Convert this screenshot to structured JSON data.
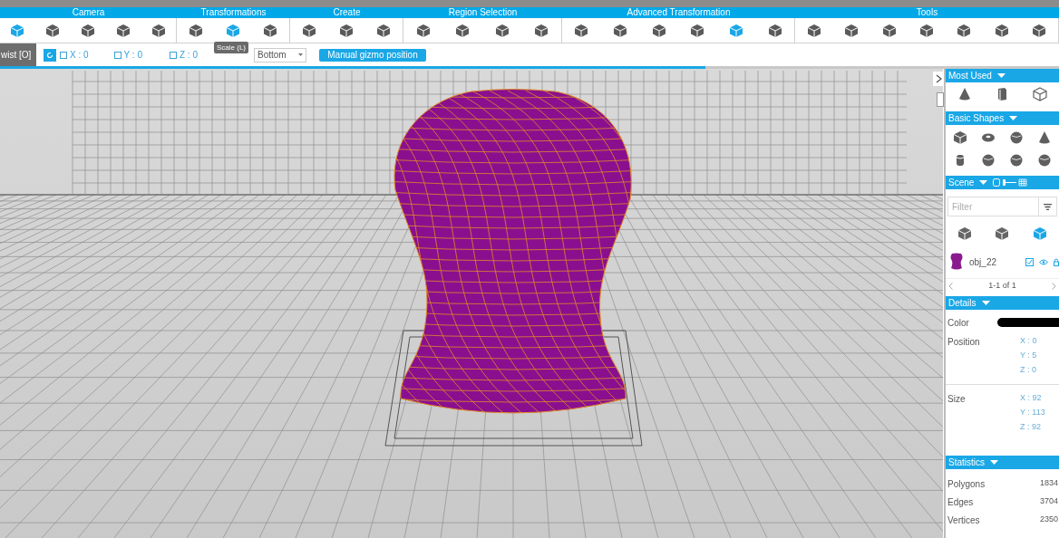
{
  "ribbon": {
    "groups": [
      {
        "label": "Camera",
        "tools": [
          {
            "selected": true
          },
          {
            "selected": false
          },
          {
            "selected": false
          },
          {
            "selected": false
          },
          {
            "selected": false
          }
        ]
      },
      {
        "label": "Transformations",
        "tools": [
          {
            "selected": false
          },
          {
            "selected": true
          },
          {
            "selected": false
          }
        ]
      },
      {
        "label": "Create",
        "tools": [
          {
            "selected": false
          },
          {
            "selected": false
          },
          {
            "selected": false
          }
        ]
      },
      {
        "label": "Region Selection",
        "tools": [
          {
            "selected": false
          },
          {
            "selected": false
          },
          {
            "selected": false
          },
          {
            "selected": false
          }
        ]
      },
      {
        "label": "Advanced Transformation",
        "tools": [
          {
            "selected": false
          },
          {
            "selected": false
          },
          {
            "selected": false
          },
          {
            "selected": false
          },
          {
            "selected": true
          },
          {
            "selected": false
          }
        ]
      },
      {
        "label": "Tools",
        "tools": [
          {
            "selected": false
          },
          {
            "selected": false
          },
          {
            "selected": false
          },
          {
            "selected": false
          },
          {
            "selected": false
          },
          {
            "selected": false
          },
          {
            "selected": false
          }
        ]
      }
    ]
  },
  "tooltip": {
    "text": "Scale (L)"
  },
  "options_bar": {
    "mode_label": "wist [O]",
    "rotate_active": true,
    "axes": [
      {
        "label": "X : 0",
        "checked": false
      },
      {
        "label": "Y : 0",
        "checked": false
      },
      {
        "label": "Z : 0",
        "checked": false
      }
    ],
    "origin_dropdown": {
      "value": "Bottom"
    },
    "gizmo_button": "Manual gizmo position",
    "progress": {
      "level": 0.666
    }
  },
  "side_panel": {
    "most_used": {
      "title": "Most Used",
      "icons": [
        {
          "kind": "cone"
        },
        {
          "kind": "box"
        },
        {
          "kind": "wire"
        }
      ]
    },
    "basic_shapes": {
      "title": "Basic Shapes",
      "icons": [
        {
          "kind": "cube"
        },
        {
          "kind": "torus"
        },
        {
          "kind": "sphere"
        },
        {
          "kind": "cone"
        },
        {
          "kind": "cylinder"
        },
        {
          "kind": "sphere"
        },
        {
          "kind": "sphere"
        },
        {
          "kind": "sphere"
        }
      ]
    },
    "scene": {
      "title": "Scene",
      "filter": {
        "placeholder": "Filter"
      },
      "view_modes": [
        {
          "selected": false
        },
        {
          "selected": false
        },
        {
          "selected": true
        }
      ],
      "objects": [
        {
          "name": "obj_22",
          "checked": true
        }
      ],
      "pager": "1-1 of 1"
    },
    "details": {
      "title": "Details",
      "color": {
        "label": "Color",
        "color": "#000000"
      },
      "position": {
        "label": "Position",
        "axes": [
          "X : 0",
          "Y : 5",
          "Z : 0"
        ]
      },
      "size": {
        "label": "Size",
        "axes": [
          "X : 92",
          "Y : 113",
          "Z : 92"
        ]
      }
    },
    "statistics": {
      "title": "Statistics",
      "rows": [
        {
          "label": "Polygons",
          "value": "1834"
        },
        {
          "label": "Edges",
          "value": "3704"
        },
        {
          "label": "Vertices",
          "value": "2350"
        }
      ]
    }
  }
}
